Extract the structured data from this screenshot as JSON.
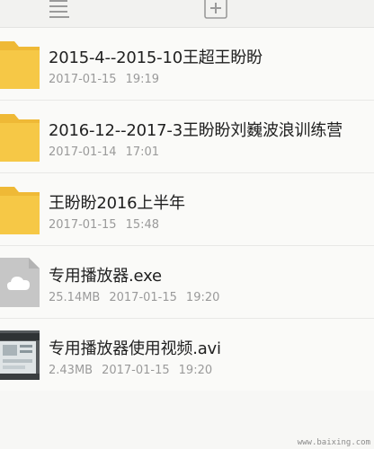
{
  "toolbar": {
    "icons": [
      "list-icon",
      "add-icon"
    ]
  },
  "files": [
    {
      "type": "folder",
      "icon": "folder-icon",
      "name": "2015-4--2015-10王超王盼盼",
      "size": "",
      "date": "2017-01-15",
      "time": "19:19"
    },
    {
      "type": "folder",
      "icon": "folder-icon",
      "name": "2016-12--2017-3王盼盼刘巍波浪训练营",
      "size": "",
      "date": "2017-01-14",
      "time": "17:01"
    },
    {
      "type": "folder",
      "icon": "folder-icon",
      "name": "王盼盼2016上半年",
      "size": "",
      "date": "2017-01-15",
      "time": "15:48"
    },
    {
      "type": "file",
      "icon": "cloud-file-icon",
      "name": "专用播放器.exe",
      "size": "25.14MB",
      "date": "2017-01-15",
      "time": "19:20"
    },
    {
      "type": "video",
      "icon": "video-thumbnail",
      "name": "专用播放器使用视频.avi",
      "size": "2.43MB",
      "date": "2017-01-15",
      "time": "19:20"
    }
  ],
  "watermark": "www.baixing.com",
  "colors": {
    "folder": "#f6c846",
    "folder_tab": "#efb936",
    "file_icon_bg": "#c6c6c6"
  }
}
